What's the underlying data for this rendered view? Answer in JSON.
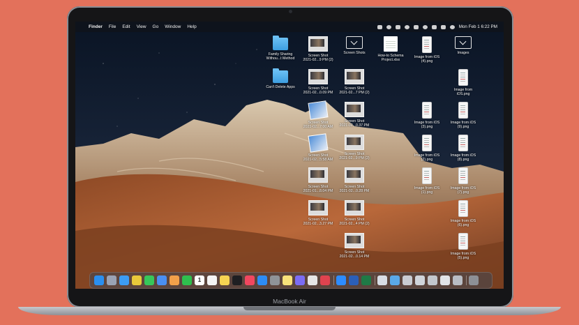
{
  "device": {
    "model_label": "MacBook Air"
  },
  "menubar": {
    "apple_glyph": "",
    "app_name": "Finder",
    "items": [
      "File",
      "Edit",
      "View",
      "Go",
      "Window",
      "Help"
    ],
    "clock": "Mon Feb 1  6:22 PM"
  },
  "desktop": {
    "items": [
      {
        "label1": "Family Sharing",
        "label2": "Withou...t Method",
        "kind": "folder"
      },
      {
        "label1": "Can't Delete Apps",
        "label2": "",
        "kind": "folder"
      },
      {
        "label1": "Screen Shot",
        "label2": "2021-02...9 PM (2)",
        "kind": "shot"
      },
      {
        "label1": "Screen Shot",
        "label2": "2021-02...0.09 PM",
        "kind": "shot"
      },
      {
        "label1": "Screen Shot",
        "label2": "2021-02...7:00 AM",
        "kind": "blue"
      },
      {
        "label1": "Screen Shot",
        "label2": "2021-02...5:58 AM",
        "kind": "blue"
      },
      {
        "label1": "Screen Shot",
        "label2": "2021-01...8.04 PM",
        "kind": "shot"
      },
      {
        "label1": "Screen Shot",
        "label2": "2021-02...3.27 PM",
        "kind": "shot"
      },
      {
        "label1": "Screen Shots",
        "label2": "",
        "kind": "chevron"
      },
      {
        "label1": "Screen Shot",
        "label2": "2021-02...7 PM (2)",
        "kind": "shot"
      },
      {
        "label1": "Screen Shot",
        "label2": "2021-02...0.37 PM",
        "kind": "shot"
      },
      {
        "label1": "Screen Shot",
        "label2": "2021-02...9 PM (2)",
        "kind": "shot"
      },
      {
        "label1": "Screen Shot",
        "label2": "2021-02...0.28 PM",
        "kind": "shot"
      },
      {
        "label1": "Screen Shot",
        "label2": "2021-02...4 PM (2)",
        "kind": "shot"
      },
      {
        "label1": "Screen Shot",
        "label2": "2021-02...0.14 PM",
        "kind": "shot"
      },
      {
        "label1": "How-to Schema",
        "label2": "Project.xlsx",
        "kind": "xlsx"
      },
      {
        "label1": "Image from iOS",
        "label2": "(4).png",
        "kind": "phone"
      },
      {
        "label1": "Image from iOS",
        "label2": "(3).png",
        "kind": "phone"
      },
      {
        "label1": "Image from iOS",
        "label2": "(2).png",
        "kind": "phone"
      },
      {
        "label1": "Image from iOS",
        "label2": "(1).png",
        "kind": "phone"
      },
      {
        "label1": "Images",
        "label2": "",
        "kind": "chevron"
      },
      {
        "label1": "Image from",
        "label2": "iOS.png",
        "kind": "phone"
      },
      {
        "label1": "Image from iOS",
        "label2": "(9).png",
        "kind": "phone"
      },
      {
        "label1": "Image from iOS",
        "label2": "(8).png",
        "kind": "phone"
      },
      {
        "label1": "Image from iOS",
        "label2": "(7).png",
        "kind": "phone"
      },
      {
        "label1": "Image from iOS",
        "label2": "(6).png",
        "kind": "phone"
      },
      {
        "label1": "Image from iOS",
        "label2": "(5).png",
        "kind": "phone"
      }
    ]
  },
  "dock": {
    "apps": [
      {
        "name": "finder-icon",
        "color": "#2a8ff0"
      },
      {
        "name": "launchpad-icon",
        "color": "#9aa3b5"
      },
      {
        "name": "safari-icon",
        "color": "#3c9cf3"
      },
      {
        "name": "chrome-icon",
        "color": "#e9c93a"
      },
      {
        "name": "messages-icon",
        "color": "#37c75a"
      },
      {
        "name": "mail-icon",
        "color": "#4a8ff2"
      },
      {
        "name": "photos-icon",
        "color": "#f2a04a"
      },
      {
        "name": "facetime-icon",
        "color": "#2fbf4e"
      },
      {
        "name": "calendar-icon",
        "color": "#ffffff"
      },
      {
        "name": "reminders-icon",
        "color": "#f4f4f4"
      },
      {
        "name": "notes-icon",
        "color": "#f6d452"
      },
      {
        "name": "tv-icon",
        "color": "#1f1f22"
      },
      {
        "name": "music-icon",
        "color": "#f1475f"
      },
      {
        "name": "app-store-icon",
        "color": "#2d8cf5"
      },
      {
        "name": "system-preferences-icon",
        "color": "#8f9398"
      },
      {
        "name": "notes-yellow-icon",
        "color": "#f8e27a"
      },
      {
        "name": "messenger-icon",
        "color": "#7b6cf4"
      },
      {
        "name": "slack-icon",
        "color": "#e6e6e6"
      },
      {
        "name": "red-app-icon",
        "color": "#e0434f"
      },
      {
        "name": "zoom-icon",
        "color": "#2d8cff"
      },
      {
        "name": "word-icon",
        "color": "#2b5fb8"
      },
      {
        "name": "excel-icon",
        "color": "#1f7a46"
      },
      {
        "name": "preview-icon",
        "color": "#d8dde5"
      },
      {
        "name": "downloads-folder-icon",
        "color": "#5aa9e8"
      },
      {
        "name": "stack-icon",
        "color": "#c9ccd2"
      },
      {
        "name": "recent-doc-icon",
        "color": "#d0d4da"
      },
      {
        "name": "recent-doc-icon",
        "color": "#c3c7cd"
      },
      {
        "name": "recent-doc-icon",
        "color": "#e2e4e8"
      },
      {
        "name": "recent-doc-icon",
        "color": "#b9bdc4"
      },
      {
        "name": "trash-icon",
        "color": "#8d9096"
      }
    ],
    "calendar_day": "1"
  }
}
